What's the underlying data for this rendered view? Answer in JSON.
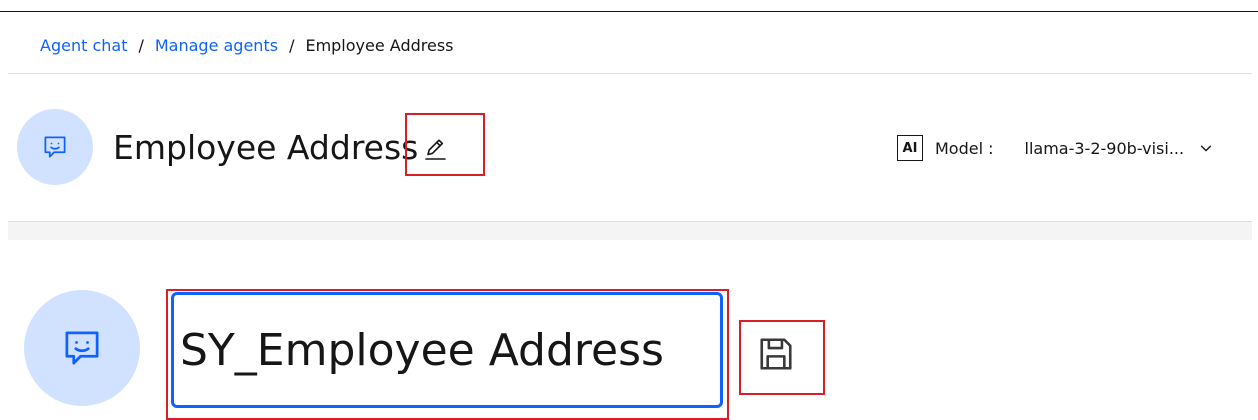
{
  "breadcrumb": {
    "items": [
      {
        "label": "Agent chat"
      },
      {
        "label": "Manage agents"
      }
    ],
    "separator": "/",
    "current": "Employee Address"
  },
  "agent": {
    "title": "Employee Address",
    "avatar_icon": "chat-bot-icon",
    "edit_icon": "pencil-edit-icon"
  },
  "model": {
    "badge": "AI",
    "label": "Model :",
    "selected": "llama-3-2-90b-visi...",
    "dropdown_icon": "chevron-down-icon"
  },
  "rename": {
    "value": "SY_Employee Address",
    "save_icon": "save-floppy-icon"
  },
  "colors": {
    "link": "#0f62fe",
    "avatar_bg": "#d0e2ff",
    "avatar_icon": "#0f62fe",
    "focus_border": "#0f62fe",
    "highlight_box": "#da1e28",
    "text": "#161616"
  }
}
